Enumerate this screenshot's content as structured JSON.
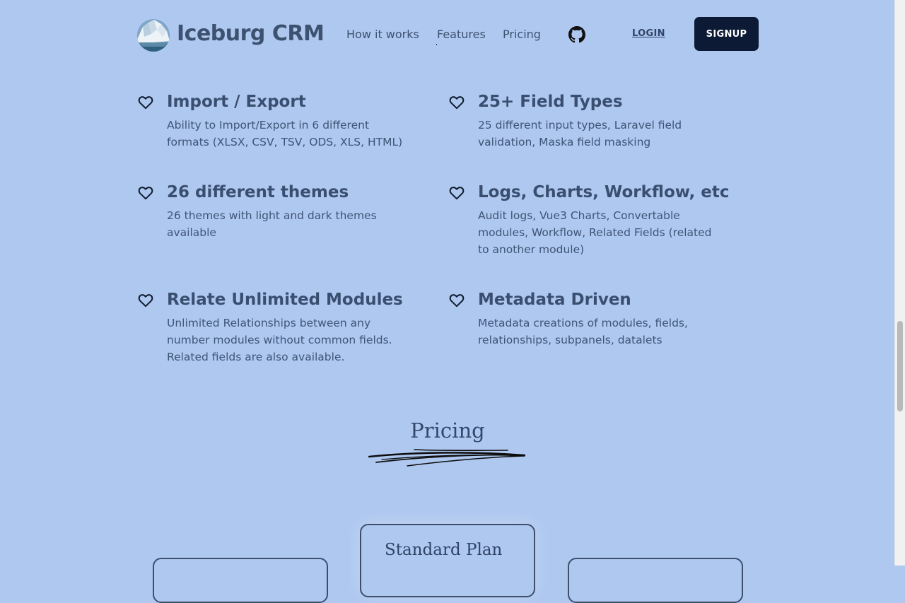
{
  "header": {
    "brand": "Iceburg CRM",
    "nav": {
      "how_it_works": "How it works",
      "features": "Features",
      "pricing": "Pricing"
    },
    "github_icon": "github-icon",
    "login": "LOGIN",
    "signup": "SIGNUP"
  },
  "features": [
    {
      "title": "Import / Export",
      "description": "Ability to Import/Export in 6 different formats (XLSX, CSV, TSV, ODS, XLS, HTML)"
    },
    {
      "title": "25+ Field Types",
      "description": "25 different input types, Laravel field validation, Maska field masking"
    },
    {
      "title": "26 different themes",
      "description": "26 themes with light and dark themes available"
    },
    {
      "title": "Logs, Charts, Workflow, etc",
      "description": "Audit logs, Vue3 Charts, Convertable modules, Workflow, Related Fields (related to another module)"
    },
    {
      "title": "Relate Unlimited Modules",
      "description": "Unlimited Relationships between any number modules without common fields. Related fields are also available."
    },
    {
      "title": "Metadata Driven",
      "description": "Metadata creations of modules, fields, relationships, subpanels, datalets"
    }
  ],
  "pricing": {
    "title": "Pricing",
    "plans": [
      {
        "name": ""
      },
      {
        "name": "Standard Plan"
      },
      {
        "name": ""
      }
    ]
  },
  "colors": {
    "background": "#afc8f0",
    "text": "#33486a",
    "signup_bg": "#0c1a36"
  }
}
